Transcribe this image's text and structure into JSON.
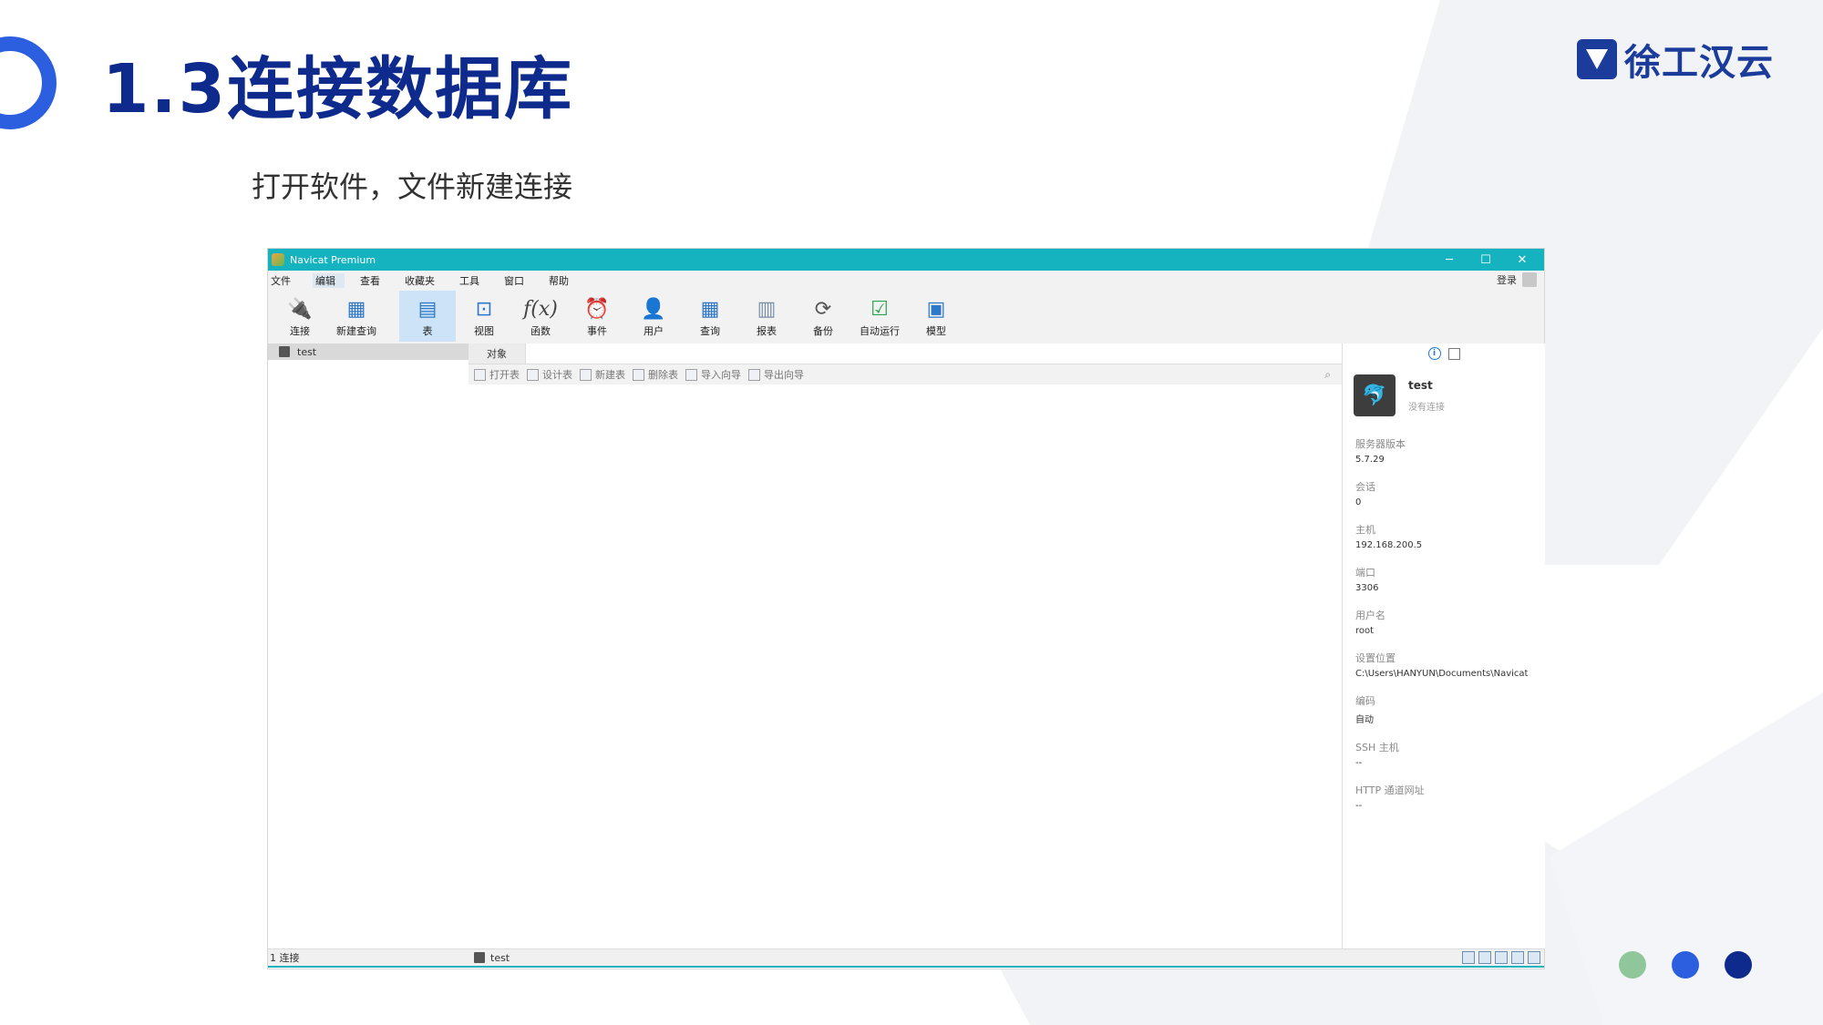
{
  "slide": {
    "title": "1.3连接数据库",
    "subtitle": "打开软件，文件新建连接",
    "logo_text": "徐工汉云",
    "accent_color": "#0e2a8c",
    "dots": [
      "#8fc79a",
      "#2b5fe0",
      "#0e2a8c"
    ]
  },
  "window": {
    "title": "Navicat Premium",
    "controls": [
      "─",
      "☐",
      "✕"
    ],
    "menu": [
      "文件",
      "编辑",
      "查看",
      "收藏夹",
      "工具",
      "窗口",
      "帮助"
    ],
    "login_label": "登录",
    "toolbar": [
      {
        "label": "连接",
        "icon": "plug-icon"
      },
      {
        "label": "新建查询",
        "icon": "new-query-icon"
      },
      {
        "label": "表",
        "icon": "table-icon"
      },
      {
        "label": "视图",
        "icon": "view-icon"
      },
      {
        "label": "函数",
        "icon": "function-icon"
      },
      {
        "label": "事件",
        "icon": "clock-icon"
      },
      {
        "label": "用户",
        "icon": "user-icon"
      },
      {
        "label": "查询",
        "icon": "query-icon"
      },
      {
        "label": "报表",
        "icon": "report-icon"
      },
      {
        "label": "备份",
        "icon": "backup-icon"
      },
      {
        "label": "自动运行",
        "icon": "automation-icon"
      },
      {
        "label": "模型",
        "icon": "model-icon"
      }
    ],
    "connection_name": "test",
    "tab_label": "对象",
    "object_actions": [
      "打开表",
      "设计表",
      "新建表",
      "删除表",
      "导入向导",
      "导出向导"
    ],
    "info": {
      "name": "test",
      "state": "没有连接",
      "props": [
        {
          "key": "服务器版本",
          "value": "5.7.29"
        },
        {
          "key": "会话",
          "value": "0"
        },
        {
          "key": "主机",
          "value": "192.168.200.5"
        },
        {
          "key": "端口",
          "value": "3306"
        },
        {
          "key": "用户名",
          "value": "root"
        },
        {
          "key": "设置位置",
          "value": "C:\\Users\\HANYUN\\Documents\\Navicat"
        },
        {
          "key": "编码",
          "value": "自动"
        },
        {
          "key": "SSH 主机",
          "value": "--"
        },
        {
          "key": "HTTP 通道网址",
          "value": "--"
        }
      ]
    },
    "status_left": "1 连接",
    "status_mid": "test"
  }
}
